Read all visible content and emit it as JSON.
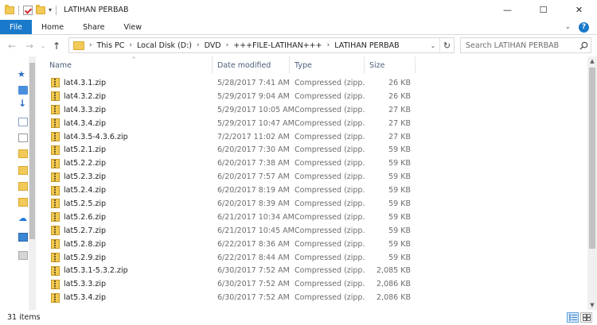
{
  "window": {
    "title": "LATIHAN PERBAB",
    "minimize_glyph": "—",
    "maximize_glyph": "☐",
    "close_glyph": "✕"
  },
  "quick_access": {
    "dropdown_glyph": "▾"
  },
  "ribbon": {
    "tabs": [
      "File",
      "Home",
      "Share",
      "View"
    ],
    "expand_glyph": "⌄",
    "help_glyph": "?"
  },
  "nav": {
    "back_glyph": "←",
    "forward_glyph": "→",
    "history_glyph": "⌄",
    "up_glyph": "↑",
    "breadcrumb_sep": "›",
    "breadcrumbs": [
      "This PC",
      "Local Disk (D:)",
      "DVD",
      "+++FILE-LATIHAN+++",
      "LATIHAN PERBAB"
    ],
    "address_dropdown_glyph": "⌄",
    "refresh_glyph": "↻",
    "search_placeholder": "Search LATIHAN PERBAB"
  },
  "nav_pane": {
    "icons": [
      "star-icon",
      "desktop-icon",
      "download-icon",
      "documents-icon",
      "pictures-icon",
      "folder-icon",
      "folder-icon",
      "folder-icon",
      "folder-icon",
      "onedrive-icon",
      "this-pc-icon",
      "drive-icon"
    ]
  },
  "columns": {
    "name": "Name",
    "date": "Date modified",
    "type": "Type",
    "size": "Size",
    "sort_glyph": "^"
  },
  "files": [
    {
      "name": "lat4.3.1.zip",
      "date": "5/28/2017 7:41 AM",
      "type": "Compressed (zipp...",
      "size": "26 KB"
    },
    {
      "name": "lat4.3.2.zip",
      "date": "5/29/2017 9:04 AM",
      "type": "Compressed (zipp...",
      "size": "26 KB"
    },
    {
      "name": "lat4.3.3.zip",
      "date": "5/29/2017 10:05 AM",
      "type": "Compressed (zipp...",
      "size": "27 KB"
    },
    {
      "name": "lat4.3.4.zip",
      "date": "5/29/2017 10:47 AM",
      "type": "Compressed (zipp...",
      "size": "27 KB"
    },
    {
      "name": "lat4.3.5-4.3.6.zip",
      "date": "7/2/2017 11:02 AM",
      "type": "Compressed (zipp...",
      "size": "27 KB"
    },
    {
      "name": "lat5.2.1.zip",
      "date": "6/20/2017 7:30 AM",
      "type": "Compressed (zipp...",
      "size": "59 KB"
    },
    {
      "name": "lat5.2.2.zip",
      "date": "6/20/2017 7:38 AM",
      "type": "Compressed (zipp...",
      "size": "59 KB"
    },
    {
      "name": "lat5.2.3.zip",
      "date": "6/20/2017 7:57 AM",
      "type": "Compressed (zipp...",
      "size": "59 KB"
    },
    {
      "name": "lat5.2.4.zip",
      "date": "6/20/2017 8:19 AM",
      "type": "Compressed (zipp...",
      "size": "59 KB"
    },
    {
      "name": "lat5.2.5.zip",
      "date": "6/20/2017 8:39 AM",
      "type": "Compressed (zipp...",
      "size": "59 KB"
    },
    {
      "name": "lat5.2.6.zip",
      "date": "6/21/2017 10:34 AM",
      "type": "Compressed (zipp...",
      "size": "59 KB"
    },
    {
      "name": "lat5.2.7.zip",
      "date": "6/21/2017 10:45 AM",
      "type": "Compressed (zipp...",
      "size": "59 KB"
    },
    {
      "name": "lat5.2.8.zip",
      "date": "6/22/2017 8:36 AM",
      "type": "Compressed (zipp...",
      "size": "59 KB"
    },
    {
      "name": "lat5.2.9.zip",
      "date": "6/22/2017 8:44 AM",
      "type": "Compressed (zipp...",
      "size": "59 KB"
    },
    {
      "name": "lat5.3.1-5.3.2.zip",
      "date": "6/30/2017 7:52 AM",
      "type": "Compressed (zipp...",
      "size": "2,085 KB"
    },
    {
      "name": "lat5.3.3.zip",
      "date": "6/30/2017 7:52 AM",
      "type": "Compressed (zipp...",
      "size": "2,086 KB"
    },
    {
      "name": "lat5.3.4.zip",
      "date": "6/30/2017 7:52 AM",
      "type": "Compressed (zipp...",
      "size": "2,086 KB"
    }
  ],
  "scrollbar": {
    "up_glyph": "▲",
    "down_glyph": "▼"
  },
  "status": {
    "item_count": "31 items"
  },
  "colors": {
    "file_tab": "#1979ca",
    "folder": "#f2ca59",
    "header_text": "#4c607a"
  }
}
